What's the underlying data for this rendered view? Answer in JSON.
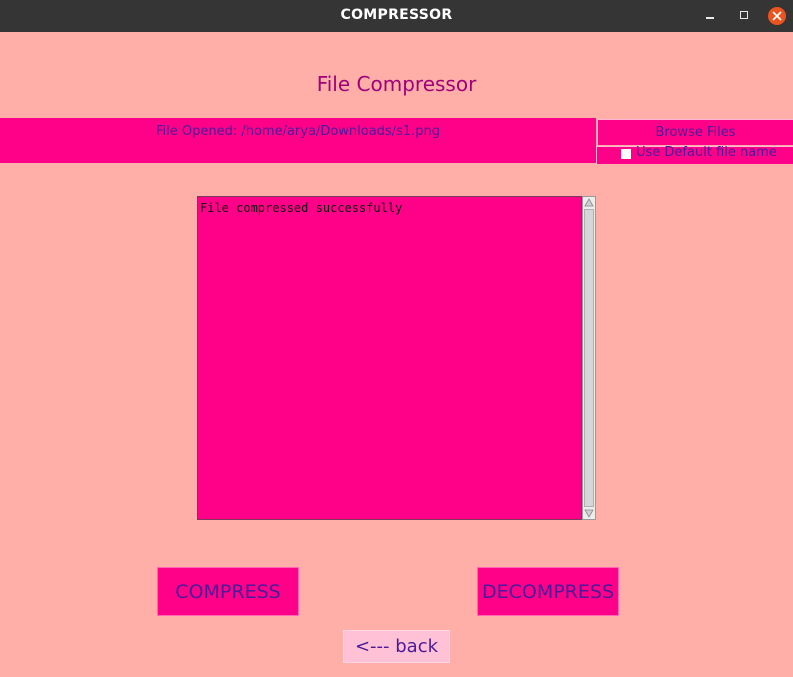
{
  "window": {
    "title": "COMPRESSOR"
  },
  "app": {
    "heading": "File Compressor"
  },
  "file_bar": {
    "opened_label": "File Opened: /home/arya/Downloads/s1.png",
    "browse_label": "Browse Files",
    "default_name_label": "Use Default file name",
    "default_name_checked": false
  },
  "output": {
    "text": "File compressed successfully"
  },
  "actions": {
    "compress_label": "COMPRESS",
    "decompress_label": "DECOMPRESS",
    "back_label": "<--- back"
  },
  "colors": {
    "background": "#ffafa8",
    "accent": "#ff0088",
    "heading_text": "#a0007a",
    "button_text": "#4a1a9a",
    "titlebar": "#353535",
    "close_button": "#e95420"
  },
  "icons": {
    "minimize": "minimize-icon",
    "maximize": "maximize-icon",
    "close": "close-icon",
    "scroll_up": "arrow-up-icon",
    "scroll_down": "arrow-down-icon"
  }
}
